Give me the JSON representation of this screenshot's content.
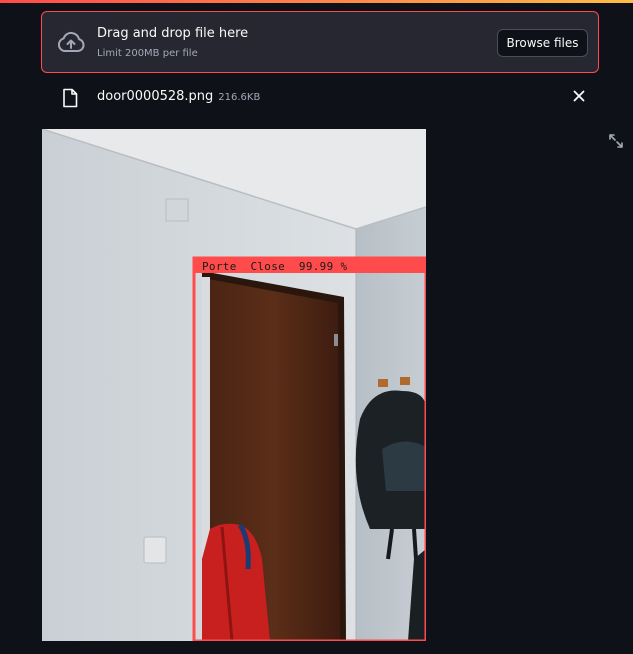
{
  "uploader": {
    "title": "Drag and drop file here",
    "limit": "Limit 200MB per file",
    "browse_label": "Browse files",
    "icon": "cloud-upload-icon"
  },
  "file": {
    "name": "door0000528.png",
    "size": "216.6KB",
    "icon": "file-icon",
    "remove_icon": "close-icon"
  },
  "image": {
    "alt": "Detected image showing a door",
    "detection_label": "Porte  Close  99.99 %",
    "box_color": "#ff4b4b"
  },
  "theme": {
    "accent": "#ff4b4b",
    "background": "#0e1117",
    "panel": "#262730"
  }
}
